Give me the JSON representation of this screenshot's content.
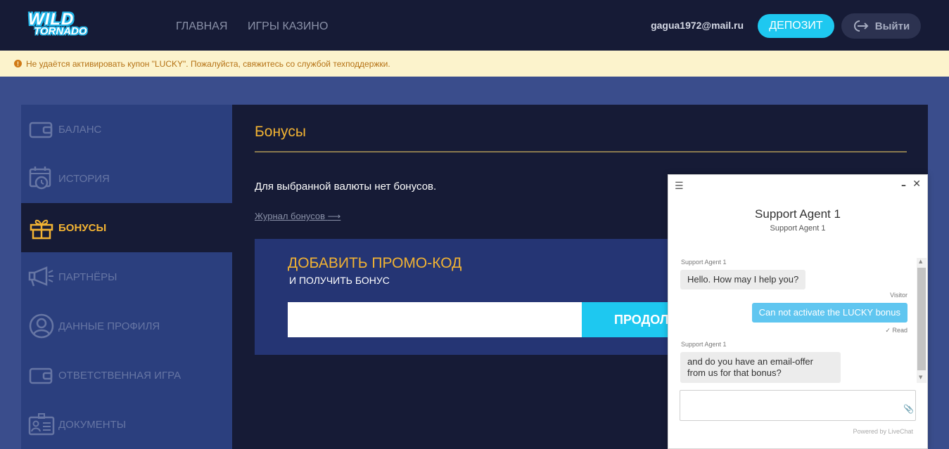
{
  "header": {
    "logo_line1": "WILD",
    "logo_line2": "TORNADO",
    "nav": [
      "Главная",
      "Игры казино"
    ],
    "user_email": "gagua1972@mail.ru",
    "deposit_label": "Депозит",
    "logout_label": "Выйти"
  },
  "alert": {
    "text": "Не удаётся активировать купон \"LUCKY\". Пожалуйста, свяжитесь со службой техподдержки."
  },
  "sidebar": {
    "items": [
      {
        "label": "Баланс",
        "icon": "wallet-icon"
      },
      {
        "label": "История",
        "icon": "calendar-clock-icon"
      },
      {
        "label": "Бонусы",
        "icon": "gift-icon",
        "active": true
      },
      {
        "label": "Партнёры",
        "icon": "megaphone-icon"
      },
      {
        "label": "Данные профиля",
        "icon": "user-icon"
      },
      {
        "label": "Ответственная игра",
        "icon": "wallet-icon"
      },
      {
        "label": "Документы",
        "icon": "id-card-icon"
      }
    ]
  },
  "main": {
    "title": "Бонусы",
    "no_bonus_text": "Для выбранной валюты нет бонусов.",
    "journal_link": "Журнал бонусов",
    "promo": {
      "title": "Добавить промо-код",
      "subtitle": "и получить бонус",
      "input_value": "",
      "button_label": "Продолжить"
    }
  },
  "chat": {
    "agent_name": "Support Agent 1",
    "agent_role": "Support Agent 1",
    "messages": [
      {
        "sender": "Support Agent 1",
        "text": "Hello. How may I help you?"
      },
      {
        "sender": "Visitor",
        "text": "Can not activate the LUCKY bonus",
        "status": "Read"
      },
      {
        "sender": "Support Agent 1",
        "text": "and do you have an email-offer from us for that bonus?"
      }
    ],
    "input_value": "",
    "powered_by": "Powered by LiveChat"
  },
  "colors": {
    "accent": "#1ec8f0",
    "gold": "#f2b333",
    "header_bg": "#161b36",
    "page_bg": "#3a4d8c",
    "sidebar_bg": "#2b3f7e"
  }
}
